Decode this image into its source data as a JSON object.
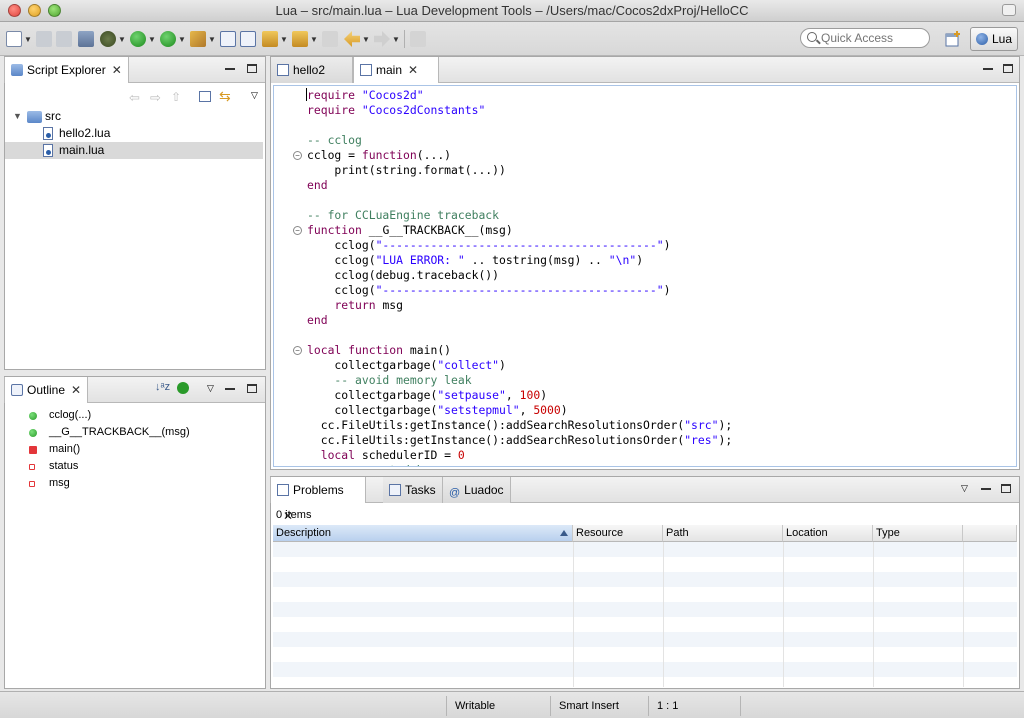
{
  "window": {
    "title": "Lua – src/main.lua – Lua Development Tools – /Users/mac/Cocos2dxProj/HelloCC"
  },
  "toolbar": {
    "quick_access_placeholder": "Quick Access",
    "perspective_label": "Lua"
  },
  "explorer": {
    "tab_label": "Script Explorer",
    "tree": [
      {
        "label": "src",
        "type": "folder"
      },
      {
        "label": "hello2.lua",
        "type": "file"
      },
      {
        "label": "main.lua",
        "type": "file",
        "selected": true
      }
    ]
  },
  "outline": {
    "tab_label": "Outline",
    "items": [
      {
        "label": "cclog(...)",
        "kind": "function"
      },
      {
        "label": "__G__TRACKBACK__(msg)",
        "kind": "function"
      },
      {
        "label": "main()",
        "kind": "local-function"
      },
      {
        "label": "status",
        "kind": "local-variable"
      },
      {
        "label": "msg",
        "kind": "local-variable"
      }
    ]
  },
  "editor": {
    "tabs": [
      {
        "label": "hello2",
        "active": false
      },
      {
        "label": "main",
        "active": true
      }
    ],
    "lines": [
      "require \"Cocos2d\"",
      "require \"Cocos2dConstants\"",
      "",
      "-- cclog",
      "cclog = function(...)",
      "    print(string.format(...))",
      "end",
      "",
      "-- for CCLuaEngine traceback",
      "function __G__TRACKBACK__(msg)",
      "    cclog(\"----------------------------------------\")",
      "    cclog(\"LUA ERROR: \" .. tostring(msg) .. \"\\n\")",
      "    cclog(debug.traceback())",
      "    cclog(\"----------------------------------------\")",
      "    return msg",
      "end",
      "",
      "local function main()",
      "    collectgarbage(\"collect\")",
      "    -- avoid memory leak",
      "    collectgarbage(\"setpause\", 100)",
      "    collectgarbage(\"setstepmul\", 5000)",
      "  cc.FileUtils:getInstance():addSearchResolutionsOrder(\"src\");",
      "  cc.FileUtils:getInstance():addSearchResolutionsOrder(\"res\");",
      "  local schedulerID = 0",
      "    --support debug"
    ]
  },
  "problems": {
    "tabs": [
      {
        "label": "Problems",
        "active": true
      },
      {
        "label": "Tasks",
        "active": false
      },
      {
        "label": "Luadoc",
        "active": false
      }
    ],
    "item_count": "0 items",
    "columns": [
      "Description",
      "Resource",
      "Path",
      "Location",
      "Type"
    ]
  },
  "statusbar": {
    "writable": "Writable",
    "insert_mode": "Smart Insert",
    "position": "1 : 1"
  },
  "colors": {
    "keyword": "#7f0055",
    "string": "#2a00ff",
    "comment": "#3f7f5f",
    "number": "#c80000"
  }
}
